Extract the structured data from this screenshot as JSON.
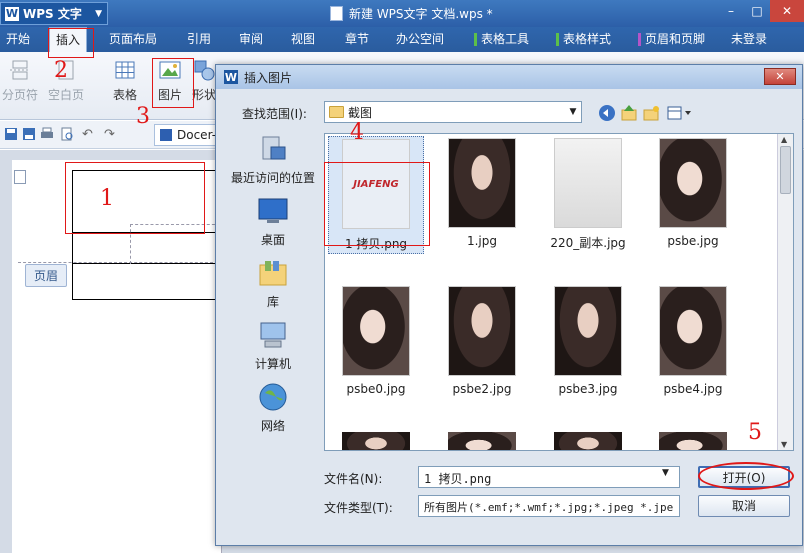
{
  "app": {
    "name": "WPS 文字",
    "logo": "W",
    "doc_title": "新建 WPS文字 文档.wps *",
    "login": "未登录"
  },
  "window": {
    "minimize": "–",
    "maximize": "□",
    "close": "✕"
  },
  "menu": [
    {
      "label": "开始"
    },
    {
      "label": "插入"
    },
    {
      "label": "页面布局"
    },
    {
      "label": "引用"
    },
    {
      "label": "审阅"
    },
    {
      "label": "视图"
    },
    {
      "label": "章节"
    },
    {
      "label": "办公空间"
    },
    {
      "label": "表格工具"
    },
    {
      "label": "表格样式"
    },
    {
      "label": "页眉和页脚"
    }
  ],
  "ribbon": {
    "page_break": "分页符",
    "blank_page": "空白页",
    "table": "表格",
    "picture": "图片",
    "shapes": "形状"
  },
  "qat": {
    "docer_tab": "Docer-"
  },
  "document": {
    "header_label": "页眉"
  },
  "dialog": {
    "title": "插入图片",
    "close_label": "✕",
    "look_in_label": "查找范围(I):",
    "look_in_value": "截图",
    "places": [
      {
        "label": "最近访问的位置"
      },
      {
        "label": "桌面"
      },
      {
        "label": "库"
      },
      {
        "label": "计算机"
      },
      {
        "label": "网络"
      }
    ],
    "files": [
      {
        "name": "1 拷贝.png",
        "thumb_text": "JIAFENG"
      },
      {
        "name": "1.jpg"
      },
      {
        "name": "220_副本.jpg"
      },
      {
        "name": "psbe.jpg"
      },
      {
        "name": "psbe0.jpg"
      },
      {
        "name": "psbe2.jpg"
      },
      {
        "name": "psbe3.jpg"
      },
      {
        "name": "psbe4.jpg"
      }
    ],
    "filename_label": "文件名(N):",
    "filename_value": "1 拷贝.png",
    "filetype_label": "文件类型(T):",
    "filetype_value": "所有图片(*.emf;*.wmf;*.jpg;*.jpeg *.jpe",
    "open_button": "打开(O)",
    "cancel_button": "取消"
  },
  "annotations": {
    "n1": "1",
    "n2": "2",
    "n3": "3",
    "n4": "4",
    "n5": "5"
  },
  "colors": {
    "accent_blue": "#2c5fa8",
    "annotation_red": "#e01818"
  }
}
